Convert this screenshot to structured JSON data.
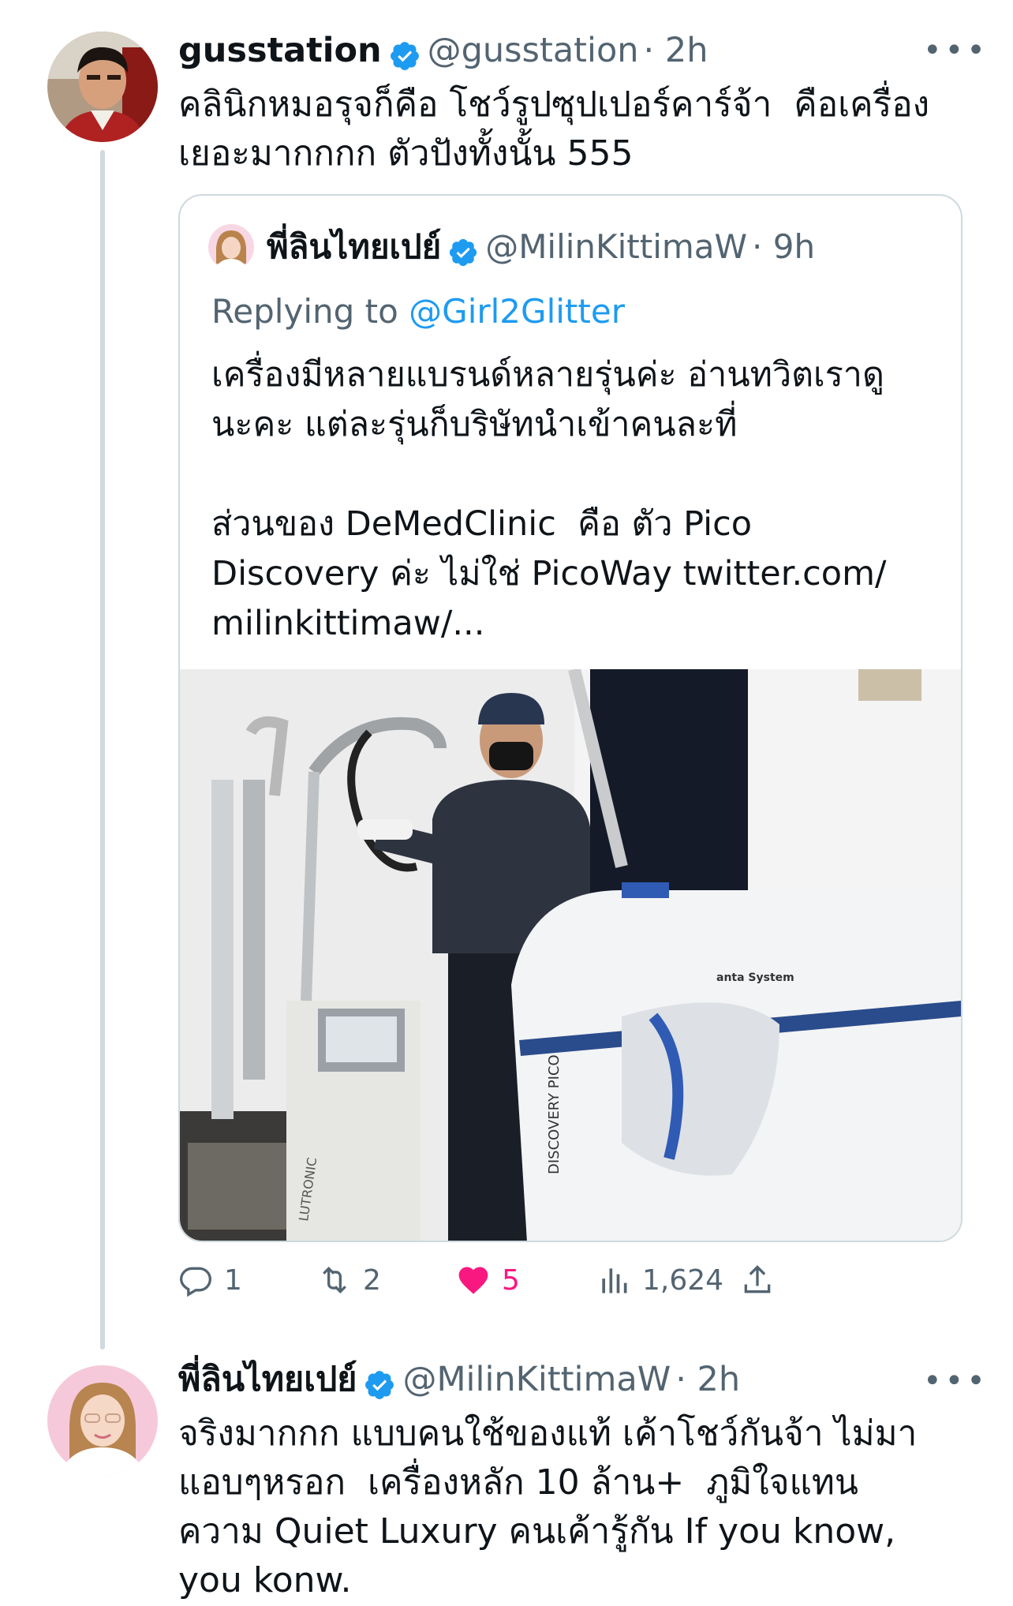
{
  "tweet1": {
    "name": "gusstation",
    "handle": "@gusstation",
    "time": "· 2h",
    "more": "•••",
    "text": "คลินิกหมอรุจก็คือ โชว์รูปซุปเปอร์คาร์จ้า  คือเครื่อง\nเยอะมากกกก ตัวปังทั้งนั้น 555"
  },
  "quote": {
    "name": "พี่ลินไทยเปย์",
    "handle": "@MilinKittimaW",
    "time": "· 9h",
    "replying_label": "Replying to",
    "replying_to": "@Girl2Glitter",
    "text": "เครื่องมีหลายแบรนด์หลายรุ่นค่ะ อ่านทวิตเราดู\nนะคะ แต่ละรุ่นก็บริษัทนำเข้าคนละที่\n\nส่วนของ DeMedClinic  คือ ตัว Pico\nDiscovery ค่ะ ไม่ใช่ PicoWay twitter.com/\nmilinkittimaw/...",
    "media_labels": {
      "brand1": "LUTRONIC",
      "brand2": "DISCOVERY PICO",
      "brand3": "anta System"
    }
  },
  "actions": {
    "replies": "1",
    "retweets": "2",
    "likes": "5",
    "views": "1,624"
  },
  "tweet2": {
    "name": "พี่ลินไทยเปย์",
    "handle": "@MilinKittimaW",
    "time": "· 2h",
    "more": "•••",
    "text": "จริงมากกก แบบคนใช้ของแท้ เค้าโชว์กันจ้า ไม่มา\nแอบๆหรอก  เครื่องหลัก 10 ล้าน+  ภูมิใจแทน\nความ Quiet Luxury คนเค้ารู้กัน If you know,\nyou konw."
  },
  "colors": {
    "verified": "#1d9bf0",
    "like": "#f91880",
    "secondary_text": "#536471",
    "border": "#cfd9de"
  },
  "icons": [
    "verified-badge-icon",
    "reply-icon",
    "retweet-icon",
    "heart-icon",
    "views-icon",
    "share-icon",
    "more-icon"
  ]
}
